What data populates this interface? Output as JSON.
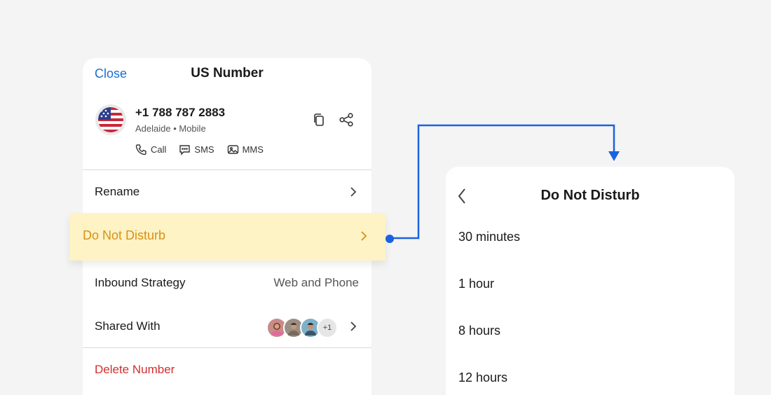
{
  "number_panel": {
    "close_label": "Close",
    "title": "US Number",
    "contact": {
      "number": "+1 788 787 2883",
      "subtitle": "Adelaide • Mobile",
      "actions": [
        {
          "label": "Call",
          "icon": "phone-icon"
        },
        {
          "label": "SMS",
          "icon": "sms-icon"
        },
        {
          "label": "MMS",
          "icon": "mms-icon"
        }
      ]
    },
    "rename_label": "Rename",
    "do_not_disturb_label": "Do Not Disturb",
    "inbound_strategy": {
      "label": "Inbound Strategy",
      "value": "Web and Phone"
    },
    "shared_with": {
      "label": "Shared With",
      "extra_count": "+1"
    },
    "delete_label": "Delete Number"
  },
  "dnd_panel": {
    "title": "Do Not Disturb",
    "options": [
      "30 minutes",
      "1 hour",
      "8 hours",
      "12 hours"
    ]
  },
  "colors": {
    "accent": "#1a6fd0",
    "highlight_bg": "#fdf3c4",
    "highlight_text": "#d9901a",
    "danger": "#d32f2f",
    "connector": "#1a62e0"
  }
}
